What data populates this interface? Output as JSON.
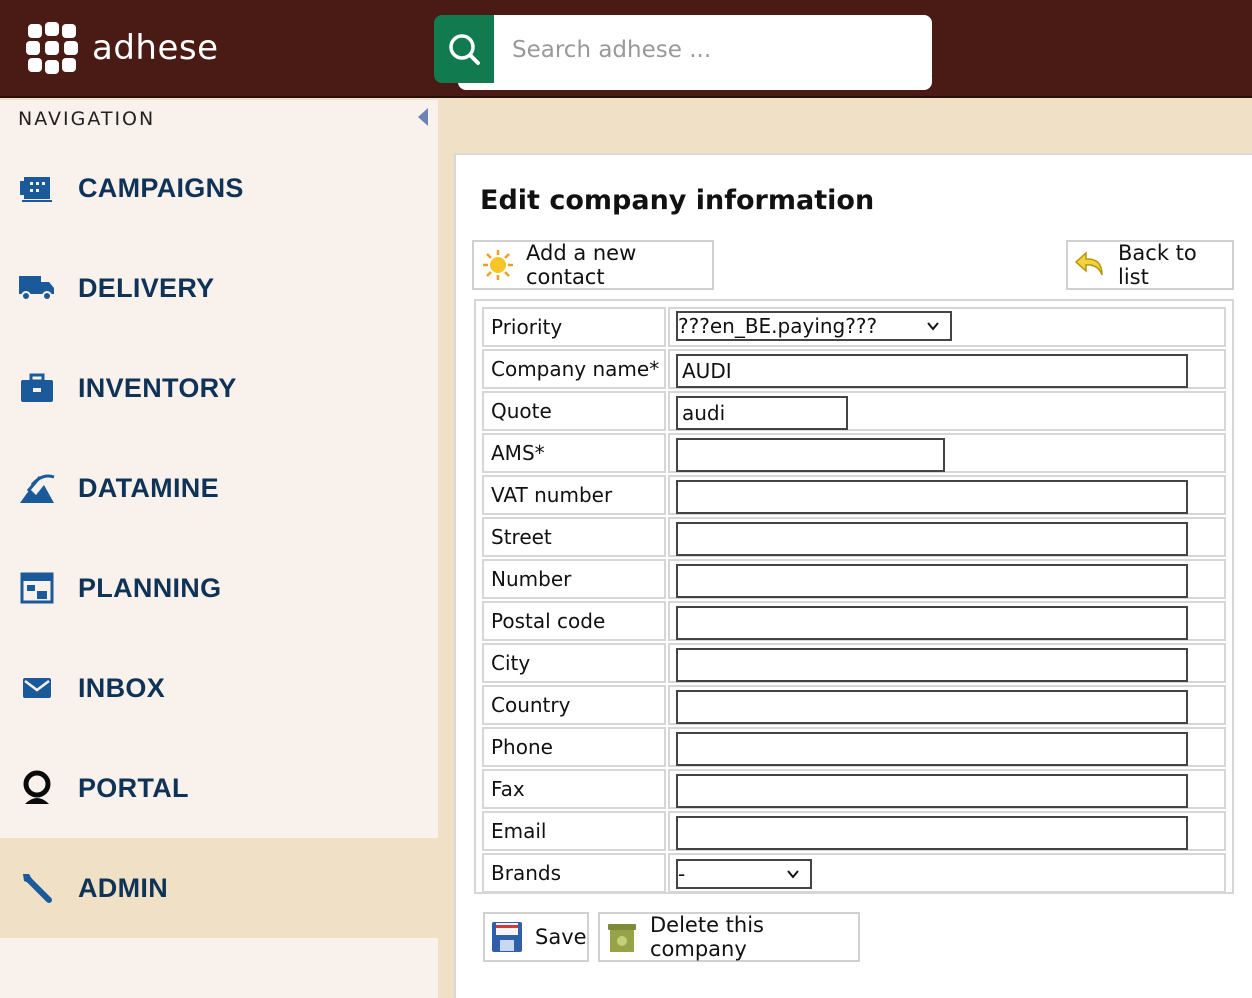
{
  "app": {
    "brand": "adhese"
  },
  "search": {
    "placeholder": "Search adhese ..."
  },
  "sidebar": {
    "title": "NAVIGATION",
    "items": [
      {
        "label": "CAMPAIGNS",
        "icon": "campaigns-icon"
      },
      {
        "label": "DELIVERY",
        "icon": "truck-icon"
      },
      {
        "label": "INVENTORY",
        "icon": "briefcase-icon"
      },
      {
        "label": "DATAMINE",
        "icon": "pickaxe-icon"
      },
      {
        "label": "PLANNING",
        "icon": "planning-icon"
      },
      {
        "label": "INBOX",
        "icon": "envelope-icon"
      },
      {
        "label": "PORTAL",
        "icon": "portal-icon"
      },
      {
        "label": "ADMIN",
        "icon": "wrench-icon",
        "active": true
      }
    ]
  },
  "page": {
    "title": "Edit company information",
    "add_contact_label": "Add a new contact",
    "back_label": "Back to list",
    "save_label": "Save",
    "delete_label": "Delete this company"
  },
  "form": {
    "priority": {
      "label": "Priority",
      "value": "???en_BE.paying???"
    },
    "company_name": {
      "label": "Company name*",
      "value": "AUDI"
    },
    "quote": {
      "label": "Quote",
      "value": "audi"
    },
    "ams": {
      "label": "AMS*",
      "value": ""
    },
    "vat": {
      "label": "VAT number",
      "value": ""
    },
    "street": {
      "label": "Street",
      "value": ""
    },
    "number": {
      "label": "Number",
      "value": ""
    },
    "postal_code": {
      "label": "Postal code",
      "value": ""
    },
    "city": {
      "label": "City",
      "value": ""
    },
    "country": {
      "label": "Country",
      "value": ""
    },
    "phone": {
      "label": "Phone",
      "value": ""
    },
    "fax": {
      "label": "Fax",
      "value": ""
    },
    "email": {
      "label": "Email",
      "value": ""
    },
    "brands": {
      "label": "Brands",
      "value": "-"
    }
  },
  "colors": {
    "topbar": "#4a1a15",
    "search_button": "#127a4f",
    "nav_text": "#0f3357",
    "nav_icon": "#1a5a9a",
    "active_bg": "#f0e1c6",
    "sidebar_bg": "#f9f1ec"
  }
}
